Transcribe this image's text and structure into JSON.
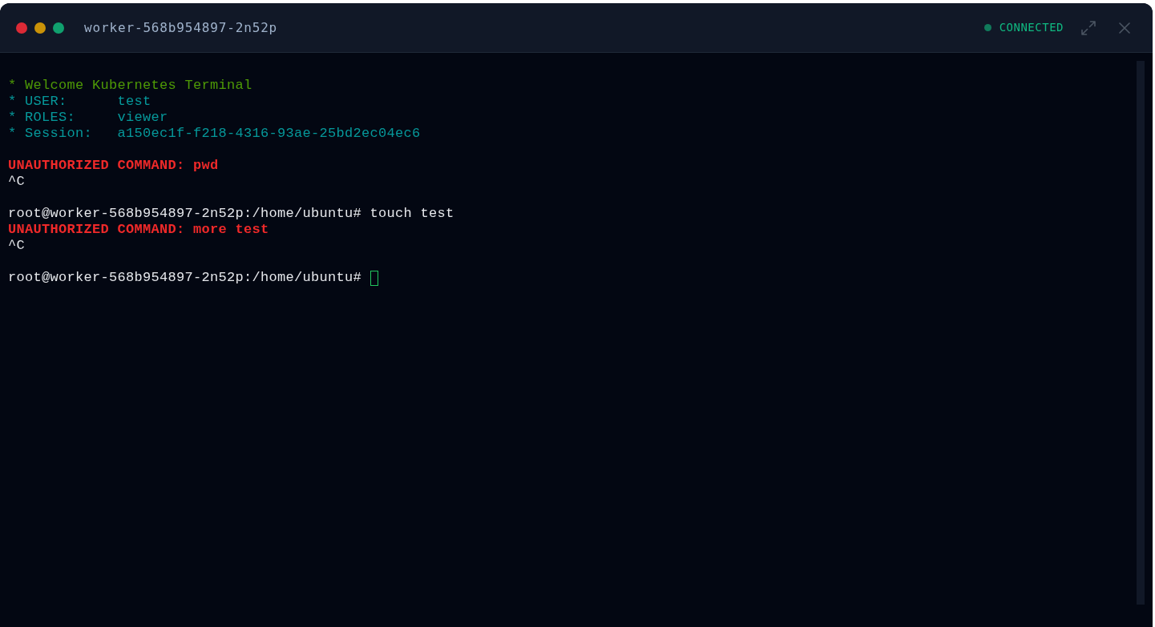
{
  "window": {
    "title": "worker-568b954897-2n52p",
    "connection": {
      "label": "CONNECTED",
      "kind": "online"
    }
  },
  "terminal": {
    "lines": [
      {
        "kind": "banner",
        "text": "* Welcome Kubernetes Terminal",
        "cursor": false
      },
      {
        "kind": "info",
        "text": "* USER:      test",
        "cursor": false
      },
      {
        "kind": "info",
        "text": "* ROLES:     viewer",
        "cursor": false
      },
      {
        "kind": "info",
        "text": "* Session:   a150ec1f-f218-4316-93ae-25bd2ec04ec6",
        "cursor": false
      },
      {
        "kind": "blank",
        "cursor": false
      },
      {
        "kind": "error",
        "text": "UNAUTHORIZED COMMAND: pwd",
        "cursor": false
      },
      {
        "kind": "output",
        "text": "^C",
        "cursor": false
      },
      {
        "kind": "blank",
        "cursor": false
      },
      {
        "kind": "prompt",
        "text": "root@worker-568b954897-2n52p:/home/ubuntu# touch test",
        "cursor": false
      },
      {
        "kind": "error",
        "text": "UNAUTHORIZED COMMAND: more test",
        "cursor": false
      },
      {
        "kind": "output",
        "text": "^C",
        "cursor": false
      },
      {
        "kind": "blank",
        "cursor": false
      },
      {
        "kind": "prompt",
        "text": "root@worker-568b954897-2n52p:/home/ubuntu#",
        "cursor": true
      }
    ]
  }
}
